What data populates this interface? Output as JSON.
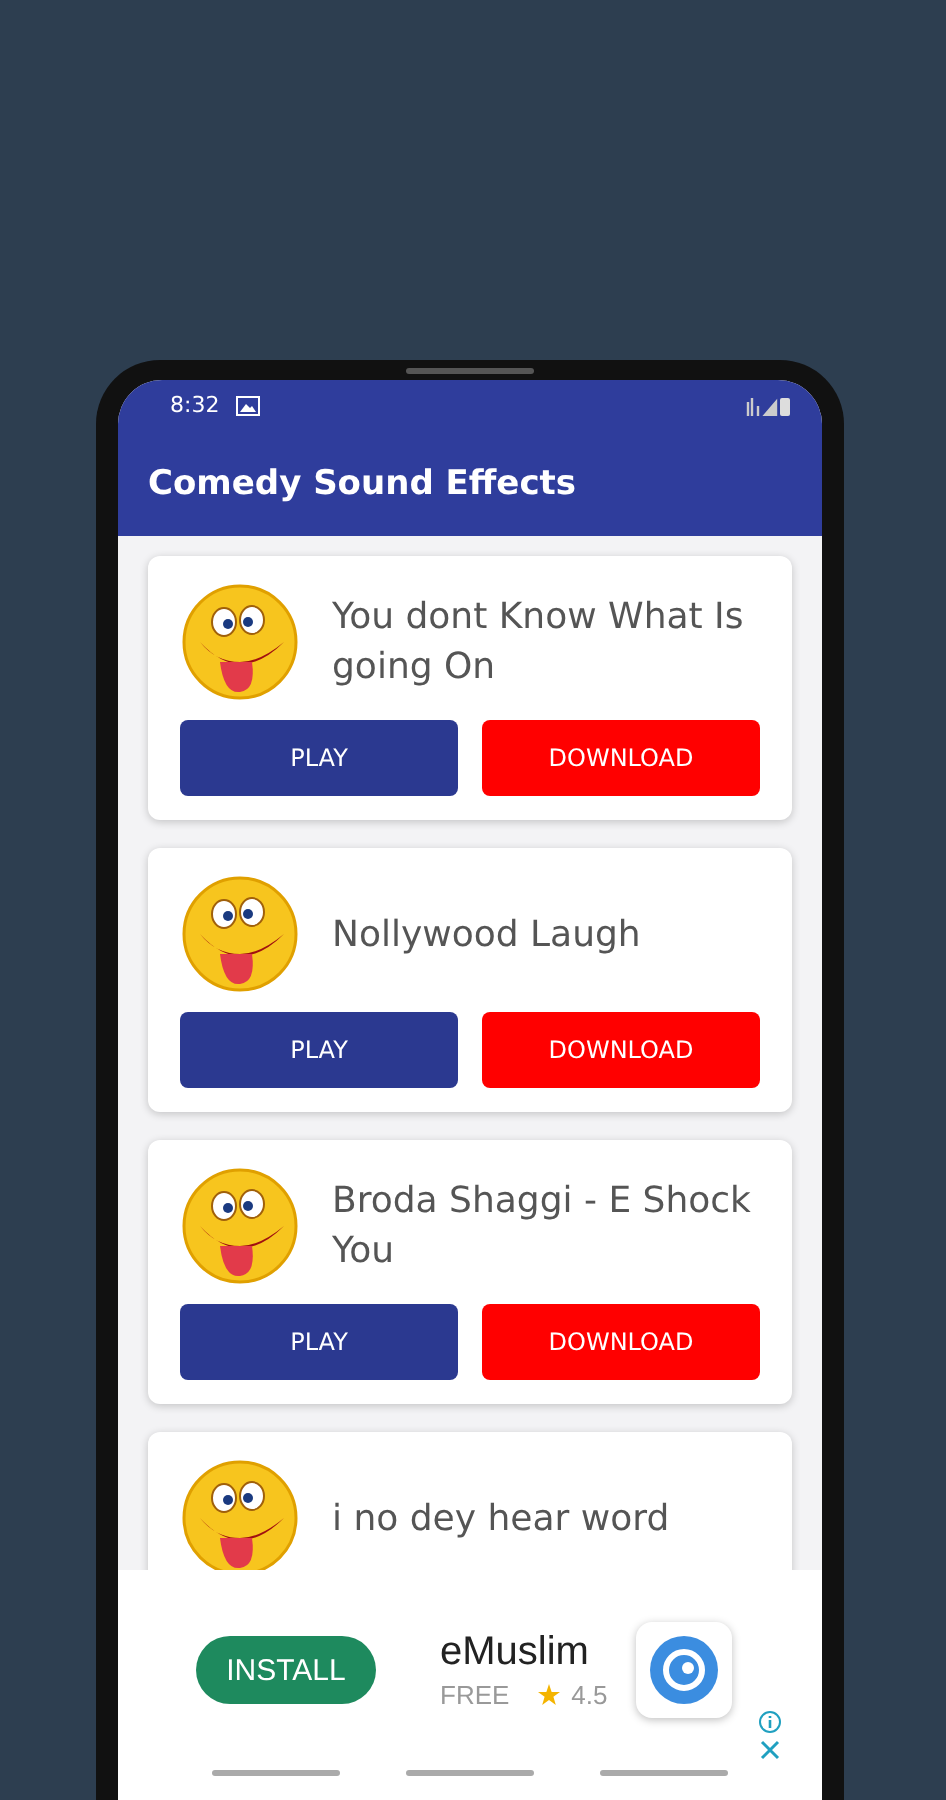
{
  "status_bar": {
    "time": "8:32"
  },
  "app_bar": {
    "title": "Comedy Sound Effects"
  },
  "sounds": [
    {
      "title": "You dont Know What Is going On",
      "play": "PLAY",
      "download": "DOWNLOAD"
    },
    {
      "title": "Nollywood Laugh",
      "play": "PLAY",
      "download": "DOWNLOAD"
    },
    {
      "title": "Broda Shaggi - E Shock You",
      "play": "PLAY",
      "download": "DOWNLOAD"
    },
    {
      "title": "i no dey hear word"
    }
  ],
  "ad": {
    "button": "INSTALL",
    "app_name": "eMuslim",
    "price": "FREE",
    "rating": "4.5"
  }
}
